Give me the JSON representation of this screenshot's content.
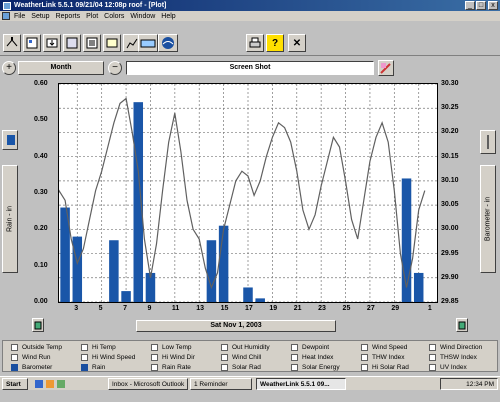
{
  "window": {
    "title": "WeatherLink 5.5.1  09/21/04  12:08p roof - [Plot]",
    "min": "_",
    "max": "□",
    "close": "x"
  },
  "menu": [
    "File",
    "Setup",
    "Reports",
    "Plot",
    "Colors",
    "Window",
    "Help"
  ],
  "controls": {
    "period": "Month",
    "view_mode": "Screen Shot",
    "zoom_in": "+",
    "zoom_out": "−"
  },
  "plot": {
    "date_label": "Sat Nov 1, 2003",
    "left_axis_label": "Rain - in",
    "right_axis_label": "Barometer - in"
  },
  "legend": {
    "rows": [
      [
        "Outside Temp",
        "Hi Temp",
        "Low Temp",
        "Out Humidity",
        "Dewpoint",
        "Wind Speed",
        "Wind Direction"
      ],
      [
        "Wind Run",
        "Hi Wind Speed",
        "Hi Wind Dir",
        "Wind Chill",
        "Heat Index",
        "THW Index",
        "THSW Index"
      ],
      [
        "Barometer",
        "Rain",
        "Rain Rate",
        "Solar Rad",
        "Solar Energy",
        "Hi Solar Rad",
        "UV Index"
      ]
    ],
    "checked": [
      "Barometer",
      "Rain"
    ]
  },
  "taskbar": {
    "start": "Start",
    "tasks": [
      "Inbox - Microsoft Outlook",
      "1 Reminder",
      "WeatherLink 5.5.1 09..."
    ],
    "clock": "12:34 PM"
  },
  "colors": {
    "bar": "#1a56a8",
    "line": "#606060",
    "title": "#0a246a"
  },
  "chart_data": {
    "type": "bar",
    "x_ticks": [
      "3",
      "5",
      "7",
      "9",
      "11",
      "13",
      "15",
      "17",
      "19",
      "21",
      "23",
      "25",
      "27",
      "29",
      "1"
    ],
    "left_axis": {
      "label": "Rain - in",
      "ylim": [
        0.0,
        0.6
      ],
      "ticks": [
        "0.00",
        "0.10",
        "0.20",
        "0.30",
        "0.40",
        "0.50",
        "0.60"
      ]
    },
    "right_axis": {
      "label": "Barometer - in",
      "ylim": [
        29.85,
        30.3
      ],
      "ticks": [
        "29.85",
        "29.90",
        "29.95",
        "30.00",
        "30.05",
        "30.10",
        "30.15",
        "30.20",
        "30.25",
        "30.30"
      ]
    },
    "series": [
      {
        "name": "Rain",
        "type": "bar",
        "days": [
          2,
          3,
          6,
          7,
          8,
          9,
          14,
          15,
          17,
          18,
          30,
          31
        ],
        "values": [
          0.26,
          0.18,
          0.17,
          0.03,
          0.55,
          0.08,
          0.17,
          0.21,
          0.04,
          0.01,
          0.34,
          0.08
        ]
      },
      {
        "name": "Barometer",
        "type": "line",
        "days": [
          1,
          1.5,
          2,
          2.5,
          3,
          3.5,
          4,
          4.5,
          5,
          5.5,
          6,
          6.5,
          7,
          7.5,
          8,
          8.5,
          9,
          9.5,
          10,
          10.5,
          11,
          11.5,
          12,
          12.5,
          13,
          13.5,
          14,
          14.5,
          15,
          15.5,
          16,
          16.5,
          17,
          17.5,
          18,
          18.5,
          19,
          19.5,
          20,
          20.5,
          21,
          21.5,
          22,
          22.5,
          23,
          23.5,
          24,
          24.5,
          25,
          25.5,
          26,
          26.5,
          27,
          27.5,
          28,
          28.5,
          29,
          29.5,
          30,
          30.5,
          31,
          31.5
        ],
        "values": [
          30.03,
          30.08,
          30.06,
          29.98,
          29.93,
          29.96,
          30.02,
          30.08,
          30.12,
          30.17,
          30.22,
          30.26,
          30.27,
          30.2,
          30.12,
          29.98,
          29.9,
          29.97,
          30.08,
          30.18,
          30.24,
          30.16,
          30.06,
          30.0,
          29.98,
          29.92,
          29.88,
          29.91,
          30.0,
          30.05,
          30.1,
          30.12,
          30.11,
          30.07,
          30.1,
          30.15,
          30.19,
          30.22,
          30.21,
          30.18,
          30.12,
          30.04,
          30.0,
          30.03,
          30.09,
          30.14,
          30.19,
          30.17,
          30.1,
          30.02,
          29.98,
          30.06,
          30.14,
          30.19,
          30.22,
          30.18,
          30.08,
          29.95,
          29.88,
          29.94,
          30.04,
          30.08
        ]
      }
    ]
  }
}
